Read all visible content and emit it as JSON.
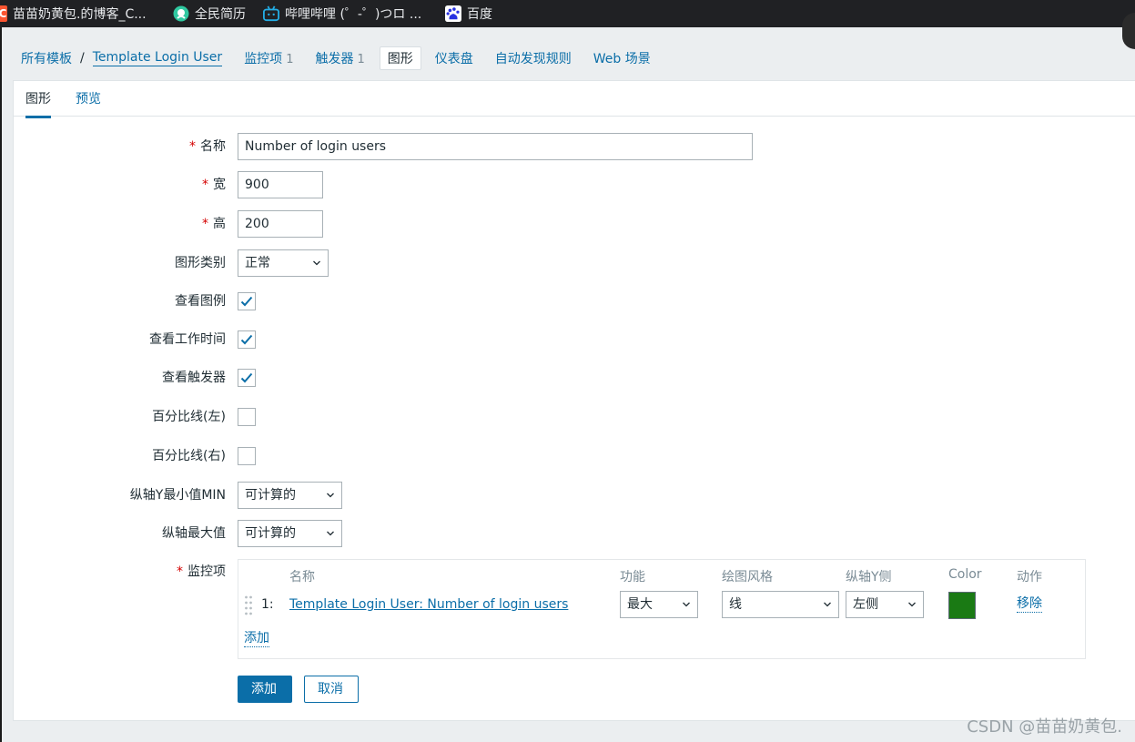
{
  "bookmarks": [
    {
      "label": "苗苗奶黄包.的博客_C...",
      "icon": "csdn-icon"
    },
    {
      "label": "全民简历",
      "icon": "resume-icon"
    },
    {
      "label": "哔哩哔哩 (゜-゜)つロ ...",
      "icon": "bilibili-icon"
    },
    {
      "label": "百度",
      "icon": "baidu-icon"
    }
  ],
  "breadcrumb": {
    "all_templates": "所有模板",
    "separator": "/",
    "template": "Template Login User"
  },
  "nav": {
    "items": {
      "label": "监控项",
      "count": "1"
    },
    "triggers": {
      "label": "触发器",
      "count": "1"
    },
    "graphs": {
      "label": "图形"
    },
    "dashboards": {
      "label": "仪表盘"
    },
    "discovery": {
      "label": "自动发现规则"
    },
    "web": {
      "label": "Web 场景"
    }
  },
  "tabs": {
    "graph": "图形",
    "preview": "预览"
  },
  "form": {
    "required_mark": "*",
    "name": {
      "label": "名称",
      "value": "Number of login users"
    },
    "width": {
      "label": "宽",
      "value": "900"
    },
    "height": {
      "label": "高",
      "value": "200"
    },
    "graph_type": {
      "label": "图形类别",
      "value": "正常"
    },
    "show_legend": {
      "label": "查看图例",
      "checked": true
    },
    "show_working_time": {
      "label": "查看工作时间",
      "checked": true
    },
    "show_triggers": {
      "label": "查看触发器",
      "checked": true
    },
    "percentile_left": {
      "label": "百分比线(左)",
      "checked": false
    },
    "percentile_right": {
      "label": "百分比线(右)",
      "checked": false
    },
    "y_min": {
      "label": "纵轴Y最小值MIN",
      "value": "可计算的"
    },
    "y_max": {
      "label": "纵轴最大值",
      "value": "可计算的"
    },
    "items_label": "监控项"
  },
  "items_table": {
    "headers": {
      "name": "名称",
      "function": "功能",
      "draw_style": "绘图风格",
      "y_side": "纵轴Y侧",
      "color": "Color",
      "action": "动作"
    },
    "rows": [
      {
        "num": "1:",
        "name": "Template Login User: Number of login users",
        "function": "最大",
        "draw_style": "线",
        "y_side": "左侧",
        "color": "#1a7a14",
        "action": "移除"
      }
    ],
    "add_label": "添加"
  },
  "buttons": {
    "add": "添加",
    "cancel": "取消"
  },
  "watermark": "CSDN @苗苗奶黄包."
}
